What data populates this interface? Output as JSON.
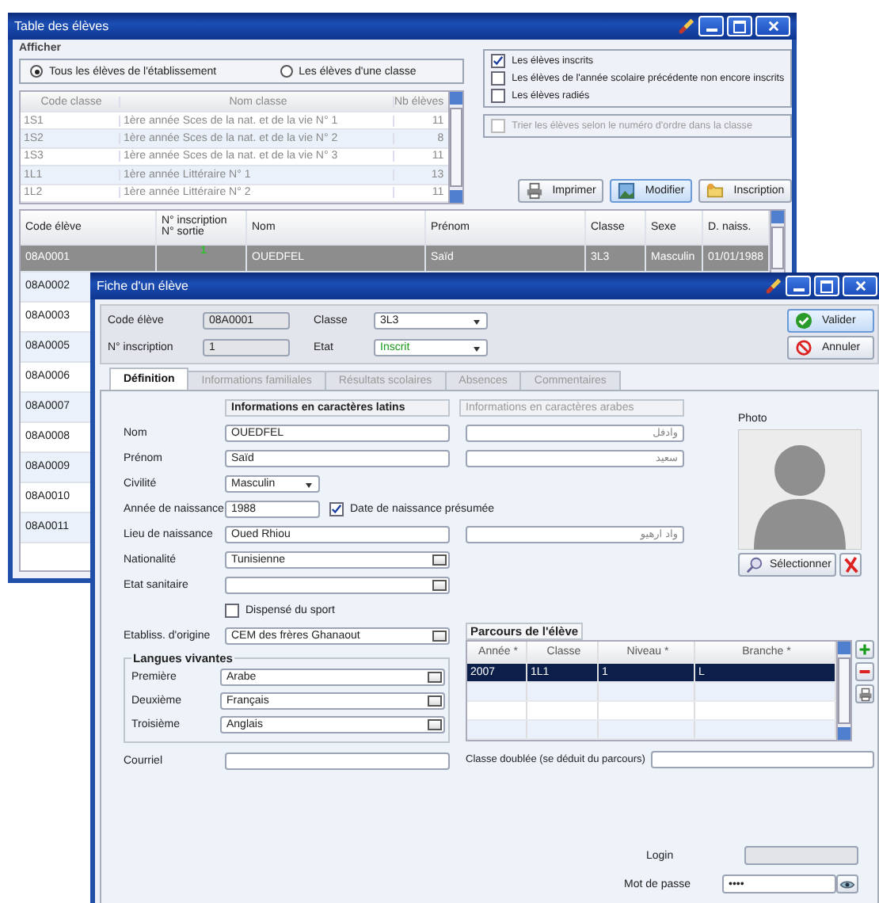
{
  "table_window": {
    "title": "Table des élèves",
    "show_label": "Afficher",
    "scope_options": [
      {
        "label": "Tous les élèves de l'établissement",
        "selected": true
      },
      {
        "label": "Les élèves d'une classe",
        "selected": false
      }
    ],
    "class_table": {
      "disabled": true,
      "columns": [
        "Code classe",
        "Nom classe",
        "Nb élèves"
      ],
      "rows": [
        {
          "code": "1S1",
          "name": "1ère année Sces de la nat. et de la vie N° 1",
          "count": "11"
        },
        {
          "code": "1S2",
          "name": "1ère année Sces de la nat. et de la vie N° 2",
          "count": "8"
        },
        {
          "code": "1S3",
          "name": "1ère année Sces de la nat. et de la vie N° 3",
          "count": "11"
        },
        {
          "code": "1L1",
          "name": "1ère année Littéraire N° 1",
          "count": "13"
        },
        {
          "code": "1L2",
          "name": "1ère année Littéraire N° 2",
          "count": "11"
        }
      ]
    },
    "filters": [
      {
        "label": "Les élèves inscrits",
        "checked": true
      },
      {
        "label": "Les élèves de l'année scolaire précédente non encore inscrits",
        "checked": false
      },
      {
        "label": "Les élèves radiés",
        "checked": false
      }
    ],
    "sort_option": {
      "label": "Trier les élèves selon le numéro d'ordre dans la classe",
      "checked": false,
      "disabled": true
    },
    "buttons": [
      {
        "label": "Imprimer",
        "kind": "print"
      },
      {
        "label": "Modifier",
        "kind": "edit"
      },
      {
        "label": "Inscription",
        "kind": "enroll"
      }
    ],
    "student_table": {
      "columns": [
        "Code élève",
        "N° inscription",
        "N° sortie",
        "Nom",
        "Prénom",
        "Classe",
        "Sexe",
        "D. naiss."
      ],
      "rows": [
        {
          "code": "08A0001",
          "inscription": "1",
          "nom": "OUEDFEL",
          "prenom": "Saïd",
          "classe": "3L3",
          "sexe": "Masculin",
          "naissance": "01/01/1988",
          "selected": true
        },
        {
          "code": "08A0002",
          "selected": false
        },
        {
          "code": "08A0003",
          "selected": false
        },
        {
          "code": "08A0005",
          "selected": false
        },
        {
          "code": "08A0006",
          "selected": false
        },
        {
          "code": "08A0007",
          "selected": false
        },
        {
          "code": "08A0008",
          "selected": false
        },
        {
          "code": "08A0009",
          "selected": false
        },
        {
          "code": "08A0010",
          "selected": false
        },
        {
          "code": "08A0011",
          "selected": false
        }
      ]
    }
  },
  "fiche_window": {
    "title": "Fiche d'un élève",
    "header": {
      "code": {
        "label": "Code élève",
        "value": "08A0001"
      },
      "classe": {
        "label": "Classe",
        "value": "3L3"
      },
      "inscription": {
        "label": "N° inscription",
        "value": "1"
      },
      "etat": {
        "label": "Etat",
        "value": "Inscrit"
      }
    },
    "buttons": [
      {
        "label": "Valider",
        "kind": "ok"
      },
      {
        "label": "Annuler",
        "kind": "cancel"
      }
    ],
    "tabs": [
      {
        "label": "Définition",
        "selected": true
      },
      {
        "label": "Informations familiales",
        "selected": false
      },
      {
        "label": "Résultats scolaires",
        "selected": false
      },
      {
        "label": "Absences",
        "selected": false
      },
      {
        "label": "Commentaires",
        "selected": false
      }
    ],
    "latin_header": "Informations en caractères latins",
    "arabic_header": "Informations en caractères arabes",
    "rows": [
      {
        "kind": "bilingual",
        "label": "Nom",
        "latin": "OUEDFEL",
        "arabic": "وادفل"
      },
      {
        "kind": "bilingual",
        "label": "Prénom",
        "latin": "Saïd",
        "arabic": "سعيد"
      },
      {
        "kind": "short_select",
        "label": "Civilité",
        "value": "Masculin"
      },
      {
        "kind": "year",
        "label": "Année de naissance",
        "value": "1988",
        "check_label": "Date de naissance présumée",
        "checked": true
      },
      {
        "kind": "bilingual",
        "label": "Lieu de naissance",
        "latin": "Oued Rhiou",
        "arabic": "واد ارهيو"
      },
      {
        "kind": "select",
        "label": "Nationalité",
        "value": "Tunisienne"
      },
      {
        "kind": "select",
        "label": "Etat sanitaire"
      },
      {
        "kind": "checkbox",
        "label": "Dispensé du sport",
        "checked": false
      }
    ],
    "photo": {
      "label": "Photo",
      "button": "Sélectionner"
    },
    "etablissement": {
      "label": "Etabliss. d'origine",
      "value": "CEM des frères Ghanaout"
    },
    "langues": {
      "title": "Langues vivantes",
      "rows": [
        {
          "label": "Première",
          "value": "Arabe"
        },
        {
          "label": "Deuxième",
          "value": "Français"
        },
        {
          "label": "Troisième",
          "value": "Anglais"
        }
      ]
    },
    "parcours": {
      "title": "Parcours de l'élève",
      "columns": [
        "Année *",
        "Classe",
        "Niveau *",
        "Branche *"
      ],
      "rows": [
        {
          "annee": "2007",
          "classe": "1L1",
          "niveau": "1",
          "branche": "L",
          "selected": true
        }
      ]
    },
    "courriel": {
      "label": "Courriel"
    },
    "classe_doublee": {
      "label": "Classe doublée (se déduit du parcours)"
    },
    "login": {
      "label": "Login"
    },
    "password": {
      "label": "Mot de passe",
      "value": "••••"
    }
  }
}
